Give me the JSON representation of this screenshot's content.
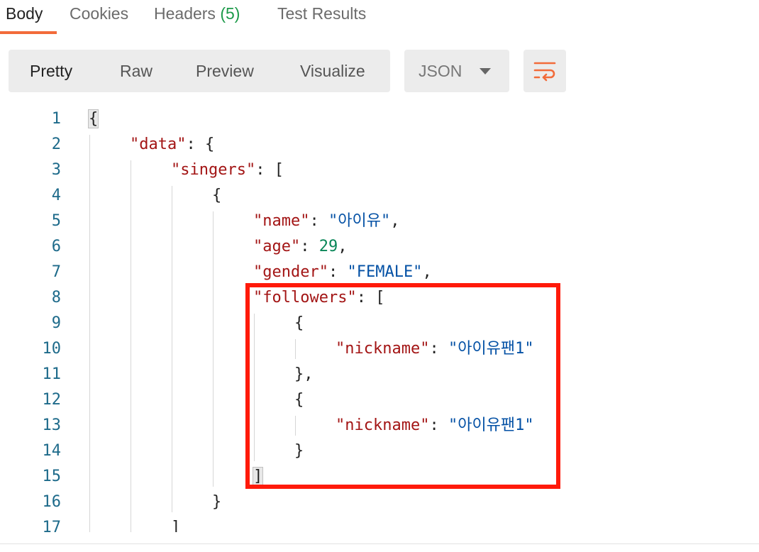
{
  "tabs": [
    {
      "label": "Body"
    },
    {
      "label": "Cookies"
    },
    {
      "label": "Headers",
      "count": "(5)"
    },
    {
      "label": "Test Results"
    }
  ],
  "view_modes": [
    "Pretty",
    "Raw",
    "Preview",
    "Visualize"
  ],
  "format": {
    "selected": "JSON"
  },
  "icons": {
    "dropdown": "chevron-down-icon",
    "wrap": "wrap-lines-icon"
  },
  "colors": {
    "accent": "#f26b3a",
    "highlight": "#ff1a0a",
    "key": "#a31515",
    "string": "#0451a5",
    "number": "#098658"
  },
  "code": {
    "line_numbers": [
      "1",
      "2",
      "3",
      "4",
      "5",
      "6",
      "7",
      "8",
      "9",
      "10",
      "11",
      "12",
      "13",
      "14",
      "15",
      "16",
      "17"
    ],
    "lines": [
      [
        {
          "t": "{",
          "c": "p"
        }
      ],
      [
        {
          "t": "\"data\"",
          "c": "k"
        },
        {
          "t": ": {",
          "c": "p"
        }
      ],
      [
        {
          "t": "\"singers\"",
          "c": "k"
        },
        {
          "t": ": [",
          "c": "p"
        }
      ],
      [
        {
          "t": "{",
          "c": "p"
        }
      ],
      [
        {
          "t": "\"name\"",
          "c": "k"
        },
        {
          "t": ": ",
          "c": "p"
        },
        {
          "t": "\"아이유\"",
          "c": "s"
        },
        {
          "t": ",",
          "c": "p"
        }
      ],
      [
        {
          "t": "\"age\"",
          "c": "k"
        },
        {
          "t": ": ",
          "c": "p"
        },
        {
          "t": "29",
          "c": "n"
        },
        {
          "t": ",",
          "c": "p"
        }
      ],
      [
        {
          "t": "\"gender\"",
          "c": "k"
        },
        {
          "t": ": ",
          "c": "p"
        },
        {
          "t": "\"FEMALE\"",
          "c": "s"
        },
        {
          "t": ",",
          "c": "p"
        }
      ],
      [
        {
          "t": "\"followers\"",
          "c": "k"
        },
        {
          "t": ": [",
          "c": "p"
        }
      ],
      [
        {
          "t": "{",
          "c": "p"
        }
      ],
      [
        {
          "t": "\"nickname\"",
          "c": "k"
        },
        {
          "t": ": ",
          "c": "p"
        },
        {
          "t": "\"아이유팬1\"",
          "c": "s"
        }
      ],
      [
        {
          "t": "},",
          "c": "p"
        }
      ],
      [
        {
          "t": "{",
          "c": "p"
        }
      ],
      [
        {
          "t": "\"nickname\"",
          "c": "k"
        },
        {
          "t": ": ",
          "c": "p"
        },
        {
          "t": "\"아이유팬1\"",
          "c": "s"
        }
      ],
      [
        {
          "t": "}",
          "c": "p"
        }
      ],
      [
        {
          "t": "]",
          "c": "p"
        }
      ],
      [
        {
          "t": "}",
          "c": "p"
        }
      ],
      [
        {
          "t": "]",
          "c": "p"
        }
      ]
    ]
  }
}
